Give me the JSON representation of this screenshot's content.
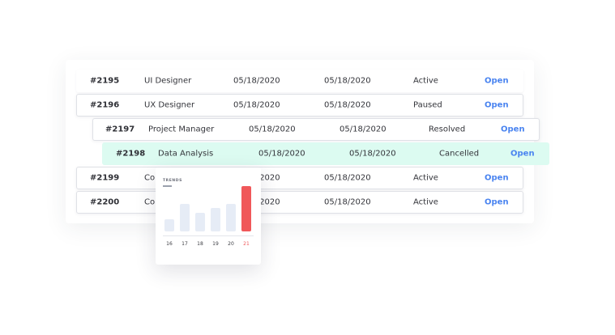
{
  "rows": [
    {
      "id": "#2195",
      "title": "UI Designer",
      "start": "05/18/2020",
      "end": "05/18/2020",
      "status": "Active",
      "action": "Open"
    },
    {
      "id": "#2196",
      "title": "UX Designer",
      "start": "05/18/2020",
      "end": "05/18/2020",
      "status": "Paused",
      "action": "Open"
    },
    {
      "id": "#2197",
      "title": "Project Manager",
      "start": "05/18/2020",
      "end": "05/18/2020",
      "status": "Resolved",
      "action": "Open"
    },
    {
      "id": "#2198",
      "title": "Data Analysis",
      "start": "05/18/2020",
      "end": "05/18/2020",
      "status": "Cancelled",
      "action": "Open"
    },
    {
      "id": "#2199",
      "title": "Co",
      "start": "05/18/2020",
      "end": "05/18/2020",
      "status": "Active",
      "action": "Open"
    },
    {
      "id": "#2200",
      "title": "Co",
      "start": "05/18/2020",
      "end": "05/18/2020",
      "status": "Active",
      "action": "Open"
    }
  ],
  "trends": {
    "title": "TRENDS",
    "highlight_color": "#f0585a",
    "bar_color": "#e6ecf6",
    "chart_data": {
      "type": "bar",
      "categories": [
        "16",
        "17",
        "18",
        "19",
        "20",
        "21"
      ],
      "values": [
        15,
        34,
        23,
        29,
        34,
        56
      ],
      "ylim": [
        0,
        56
      ]
    }
  }
}
